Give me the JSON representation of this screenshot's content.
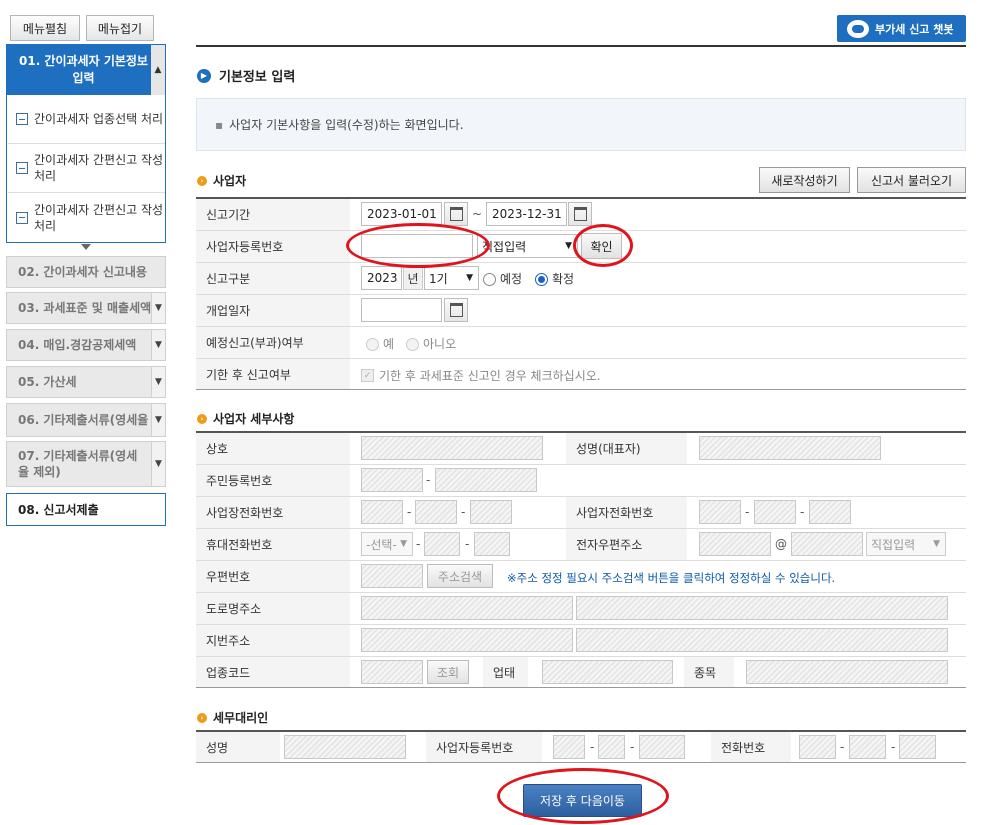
{
  "top_buttons": {
    "expand": "메뉴펼침",
    "collapse": "메뉴접기",
    "chatbot": "부가세 신고 챗봇"
  },
  "sidebar": {
    "active": "01. 간이과세자 기본정보입력",
    "sub_items": [
      "간이과세자 업종선택 처리",
      "간이과세자 간편신고 작성 처리",
      "간이과세자 간편신고 작성 처리"
    ],
    "items": [
      "02. 간이과세자 신고내용",
      "03. 과세표준 및 매출세액",
      "04. 매입.경감공제세액",
      "05. 가산세",
      "06. 기타제출서류(영세율",
      "07. 기타제출서류(영세율 제외)",
      "08. 신고서제출"
    ]
  },
  "page": {
    "title": "기본정보 입력",
    "notice": "사업자 기본사항을 입력(수정)하는 화면입니다."
  },
  "business": {
    "section": "사업자",
    "new_button": "새로작성하기",
    "load_button": "신고서 불러오기",
    "period_label": "신고기간",
    "period_start": "2023-01-01",
    "period_end": "2023-12-31",
    "tilde": "~",
    "regno_label": "사업자등록번호",
    "regno_select": "직접입력",
    "confirm_button": "확인",
    "type_label": "신고구분",
    "year": "2023",
    "year_unit": "년",
    "term": "1기",
    "opt_prelim": "예정",
    "opt_final": "확정",
    "open_label": "개업일자",
    "prelim_label": "예정신고(부과)여부",
    "yes": "예",
    "no": "아니오",
    "late_label": "기한 후 신고여부",
    "late_text": "기한 후 과세표준 신고인 경우 체크하십시오."
  },
  "detail": {
    "section": "사업자 세부사항",
    "trade_name": "상호",
    "rep_name": "성명(대표자)",
    "rrn": "주민등록번호",
    "biz_phone": "사업장전화번호",
    "owner_phone": "사업자전화번호",
    "mobile": "휴대전화번호",
    "mobile_select": "-선택-",
    "email": "전자우편주소",
    "at": "@",
    "email_select": "직접입력",
    "zip": "우편번호",
    "zip_button": "주소검색",
    "zip_note": "※주소 정정 필요시 주소검색 버튼을 클릭하여 정정하실 수 있습니다.",
    "road_addr": "도로명주소",
    "lot_addr": "지번주소",
    "industry_code": "업종코드",
    "lookup_button": "조회",
    "business_type": "업태",
    "item": "종목",
    "dash": "-"
  },
  "agent": {
    "section": "세무대리인",
    "name": "성명",
    "regno": "사업자등록번호",
    "phone": "전화번호"
  },
  "footer": {
    "save_next": "저장 후 다음이동"
  },
  "colors": {
    "accent": "#1e6fc0",
    "section_dot": "#f09a1a",
    "highlight_ring": "#e0141c",
    "save_button": "#3b6fb2"
  }
}
